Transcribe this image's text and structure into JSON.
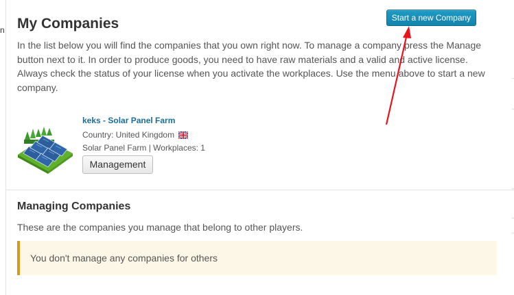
{
  "page": {
    "title": "My Companies",
    "left_fragment": "n",
    "intro": "In the list below you will find the companies that you own right now. To manage a company press the Manage button next to it. In order to produce goods, you need to have raw materials and a valid and active license. Always check the status of your license when you activate the workplaces. Use the menu above to start a new company."
  },
  "toolbar": {
    "new_company_label": "Start a new Company"
  },
  "companies": [
    {
      "name": "keks - Solar Panel Farm",
      "country": "Country: United Kingdom",
      "flag_icon": "uk-flag-icon",
      "meta": "Solar Panel Farm | Workplaces: 1",
      "manage_label": "Management",
      "image_icon": "solar-panel-farm-icon"
    }
  ],
  "managing": {
    "title": "Managing Companies",
    "description": "These are the companies you manage that belong to other players.",
    "empty_message": "You don't manage any companies for others"
  },
  "colors": {
    "primary_button": "#1a8fba",
    "link": "#1a6e9a",
    "alert_bg": "#fcf7e7",
    "alert_border": "#d89a1a",
    "annotation_arrow": "#e8141a"
  }
}
